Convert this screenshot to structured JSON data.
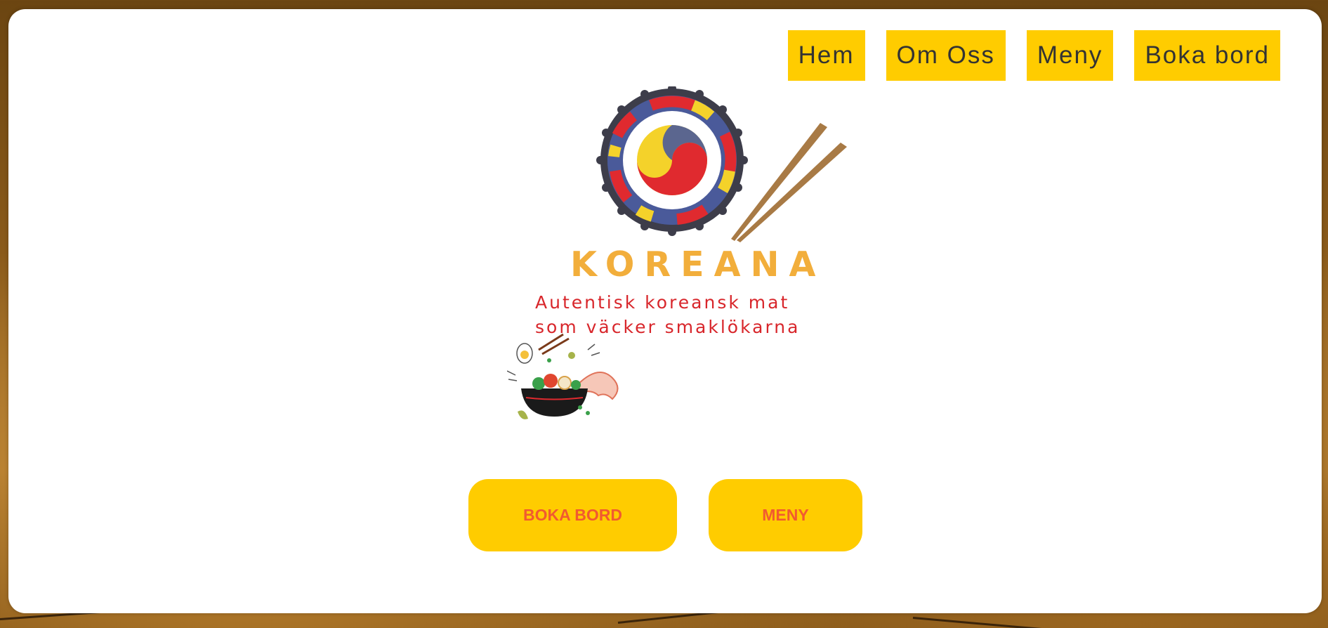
{
  "nav": {
    "items": [
      {
        "label": "Hem"
      },
      {
        "label": "Om Oss"
      },
      {
        "label": "Meny"
      },
      {
        "label": "Boka bord"
      }
    ]
  },
  "hero": {
    "brand": "KOREANA",
    "tagline_line1": "Autentisk koreansk mat",
    "tagline_line2": "som väcker smaklökarna",
    "logo_icon": "taegeuk-chopsticks-logo",
    "illustration_icon": "noodle-bowl-illustration"
  },
  "buttons": {
    "book_label": "BOKA BORD",
    "menu_label": "MENY"
  },
  "colors": {
    "accent_yellow": "#ffcc00",
    "button_text": "#f15a30",
    "brand_orange": "#f2ae3b",
    "tagline_red": "#d8262b",
    "nav_text": "#333333"
  }
}
